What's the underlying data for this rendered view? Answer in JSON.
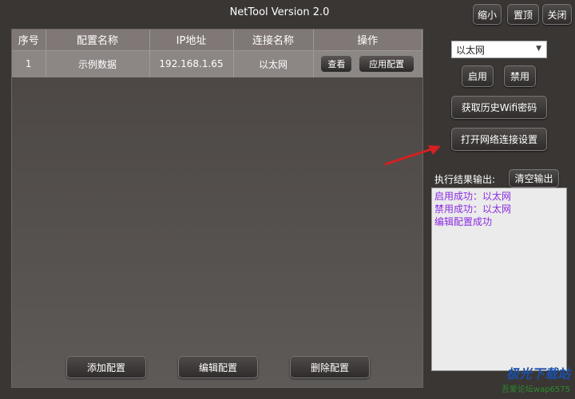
{
  "window": {
    "title": "NetTool Version 2.0",
    "minimize_label": "缩小",
    "pin_label": "置顶",
    "close_label": "关闭"
  },
  "table": {
    "headers": [
      "序号",
      "配置名称",
      "IP地址",
      "连接名称",
      "操作"
    ],
    "rows": [
      {
        "index": "1",
        "name": "示例数据",
        "ip": "192.168.1.65",
        "connection": "以太网",
        "view_label": "查看",
        "apply_label": "应用配置"
      }
    ]
  },
  "bottom_buttons": {
    "add_label": "添加配置",
    "edit_label": "编辑配置",
    "delete_label": "删除配置"
  },
  "adapter": {
    "selected": "以太网",
    "enable_label": "启用",
    "disable_label": "禁用"
  },
  "actions": {
    "wifi_history_label": "获取历史Wifi密码",
    "open_network_settings_label": "打开网络连接设置"
  },
  "output": {
    "label": "执行结果输出:",
    "clear_label": "清空输出",
    "lines": [
      "启用成功：以太网",
      "禁用成功：以太网",
      "编辑配置成功"
    ]
  },
  "watermark": {
    "title": "极光下载站",
    "subtitle": "吾爱论坛wap6575"
  },
  "colors": {
    "background": "#3a3634",
    "output_text": "#8a2be2",
    "arrow": "#d42020"
  }
}
